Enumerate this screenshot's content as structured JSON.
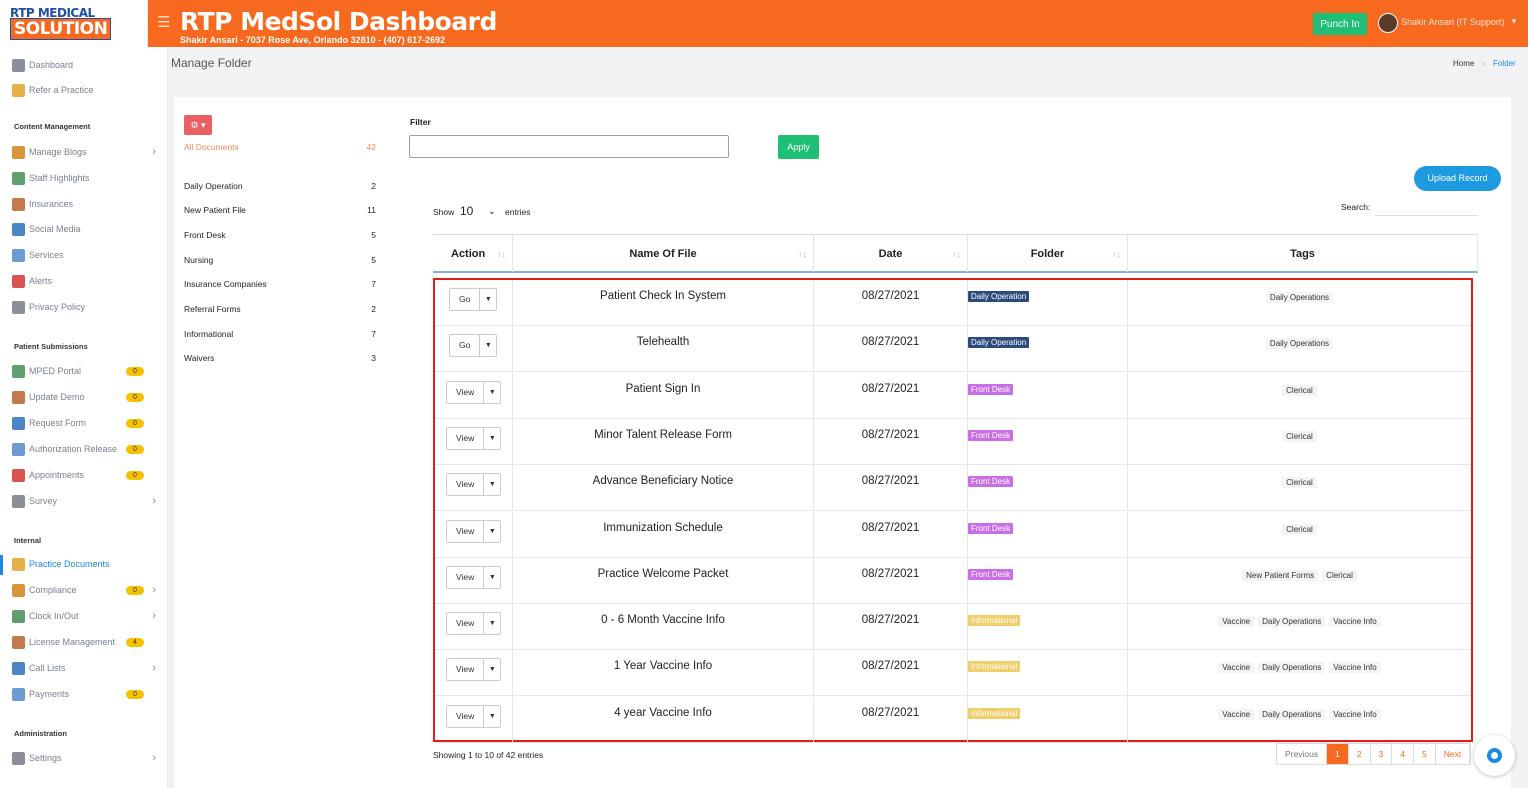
{
  "header": {
    "logo_top": "RTP MEDICAL",
    "logo_bottom": "SOLUTION",
    "title": "RTP MedSol Dashboard",
    "subtitle": "Shakir Ansari - 7037 Rose Ave, Orlando 32810 - (407) 617-2692",
    "punch_label": "Punch In",
    "user_name": "Shakir Ansari (IT Support)",
    "brand_color": "#f6691e"
  },
  "sidebar": {
    "top": [
      {
        "label": "Dashboard",
        "icon": "dashboard-icon"
      },
      {
        "label": "Refer a Practice",
        "icon": "refer-icon"
      }
    ],
    "content_heading": "Content Management",
    "content": [
      {
        "label": "Manage Blogs",
        "icon": "blog-icon"
      },
      {
        "label": "Staff Highlights",
        "icon": "staff-icon"
      },
      {
        "label": "Insurances",
        "icon": "insurance-icon"
      },
      {
        "label": "Social Media",
        "icon": "social-icon"
      },
      {
        "label": "Services",
        "icon": "services-icon"
      },
      {
        "label": "Alerts",
        "icon": "alert-icon"
      },
      {
        "label": "Privacy Policy",
        "icon": "privacy-icon"
      }
    ],
    "patient_heading": "Patient Submissions",
    "patient": [
      {
        "label": "MPED Portal",
        "badge": "0"
      },
      {
        "label": "Update Demo",
        "badge": "0"
      },
      {
        "label": "Request Form",
        "badge": "0"
      },
      {
        "label": "Authorization Release",
        "badge": "0"
      },
      {
        "label": "Appointments",
        "badge": "0"
      },
      {
        "label": "Survey"
      }
    ],
    "internal_heading": "Internal",
    "internal": [
      {
        "label": "Practice Documents"
      },
      {
        "label": "Compliance",
        "badge": "0"
      },
      {
        "label": "Clock In/Out"
      },
      {
        "label": "License Management",
        "badge": "4"
      },
      {
        "label": "Call Lists"
      },
      {
        "label": "Payments",
        "badge": "0"
      }
    ],
    "admin_heading": "Administration",
    "admin": [
      {
        "label": "Settings"
      }
    ]
  },
  "page": {
    "title": "Manage Folder",
    "crumb_home": "Home",
    "crumb_current": "Folder"
  },
  "folders": [
    {
      "name": "All Documents",
      "count": "42"
    },
    {
      "name": "Daily Operation",
      "count": "2"
    },
    {
      "name": "New Patient File",
      "count": "11"
    },
    {
      "name": "Front Desk",
      "count": "5"
    },
    {
      "name": "Nursing",
      "count": "5"
    },
    {
      "name": "Insurance Companies",
      "count": "7"
    },
    {
      "name": "Referral Forms",
      "count": "2"
    },
    {
      "name": "Informational",
      "count": "7"
    },
    {
      "name": "Waivers",
      "count": "3"
    }
  ],
  "filter": {
    "label": "Filter",
    "value": "",
    "apply": "Apply",
    "upload": "Upload Record"
  },
  "table_controls": {
    "show": "Show",
    "show_value": "10",
    "entries": "entries",
    "search": "Search:"
  },
  "table": {
    "headers": [
      "Action",
      "Name Of File",
      "Date",
      "Folder",
      "Tags"
    ],
    "rows": [
      {
        "action": "Go",
        "name": "Patient Check In System",
        "date": "08/27/2021",
        "folder": "Daily Operation",
        "tags": [
          "Daily Operations"
        ]
      },
      {
        "action": "Go",
        "name": "Telehealth",
        "date": "08/27/2021",
        "folder": "Daily Operation",
        "tags": [
          "Daily Operations"
        ]
      },
      {
        "action": "View",
        "name": "Patient Sign In",
        "date": "08/27/2021",
        "folder": "Front Desk",
        "tags": [
          "Clerical"
        ]
      },
      {
        "action": "View",
        "name": "Minor Talent Release Form",
        "date": "08/27/2021",
        "folder": "Front Desk",
        "tags": [
          "Clerical"
        ]
      },
      {
        "action": "View",
        "name": "Advance Beneficiary Notice",
        "date": "08/27/2021",
        "folder": "Front Desk",
        "tags": [
          "Clerical"
        ]
      },
      {
        "action": "View",
        "name": "Immunization Schedule",
        "date": "08/27/2021",
        "folder": "Front Desk",
        "tags": [
          "Clerical"
        ]
      },
      {
        "action": "View",
        "name": "Practice Welcome Packet",
        "date": "08/27/2021",
        "folder": "Front Desk",
        "tags": [
          "New Patient Forms",
          "Clerical"
        ]
      },
      {
        "action": "View",
        "name": "0 - 6 Month Vaccine Info",
        "date": "08/27/2021",
        "folder": "Informational",
        "tags": [
          "Vaccine",
          "Daily Operations",
          "Vaccine Info"
        ]
      },
      {
        "action": "View",
        "name": "1 Year Vaccine Info",
        "date": "08/27/2021",
        "folder": "Informational",
        "tags": [
          "Vaccine",
          "Daily Operations",
          "Vaccine Info"
        ]
      },
      {
        "action": "View",
        "name": "4 year Vaccine Info",
        "date": "08/27/2021",
        "folder": "Informational",
        "tags": [
          "Vaccine",
          "Daily Operations",
          "Vaccine Info"
        ]
      }
    ],
    "folder_colors": {
      "Daily Operation": "#2c4a7a",
      "Front Desk": "#c86ee6",
      "Informational": "#f0cf6a"
    }
  },
  "footer": {
    "showing": "Showing 1 to 10 of 42 entries",
    "pages": [
      "Previous",
      "1",
      "2",
      "3",
      "4",
      "5",
      "Next"
    ],
    "active_page": "1"
  }
}
